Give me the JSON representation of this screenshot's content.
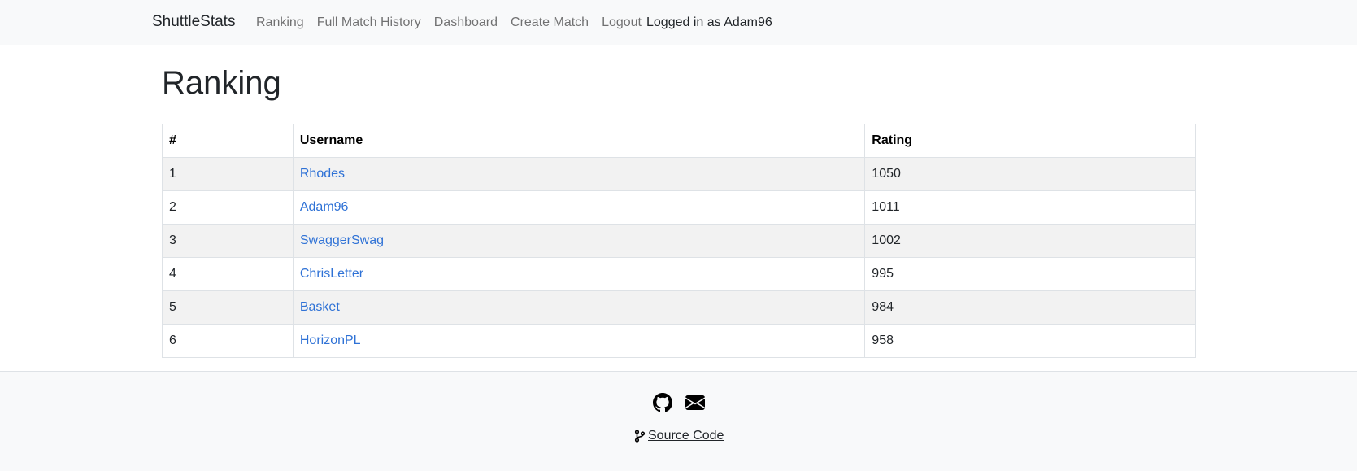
{
  "nav": {
    "brand": "ShuttleStats",
    "links": [
      "Ranking",
      "Full Match History",
      "Dashboard",
      "Create Match",
      "Logout"
    ],
    "user_status": "Logged in as Adam96"
  },
  "page": {
    "title": "Ranking"
  },
  "table": {
    "headers": [
      "#",
      "Username",
      "Rating"
    ],
    "rows": [
      {
        "rank": "1",
        "username": "Rhodes",
        "rating": "1050"
      },
      {
        "rank": "2",
        "username": "Adam96",
        "rating": "1011"
      },
      {
        "rank": "3",
        "username": "SwaggerSwag",
        "rating": "1002"
      },
      {
        "rank": "4",
        "username": "ChrisLetter",
        "rating": "995"
      },
      {
        "rank": "5",
        "username": "Basket",
        "rating": "984"
      },
      {
        "rank": "6",
        "username": "HorizonPL",
        "rating": "958"
      }
    ]
  },
  "footer": {
    "icons": [
      "github-icon",
      "envelope-icon",
      "git-branch-icon"
    ],
    "source_label": " Source Code"
  },
  "colors": {
    "link": "#2f72d6",
    "navbar_bg": "#f8f9fa",
    "stripe": "#f2f2f2"
  }
}
